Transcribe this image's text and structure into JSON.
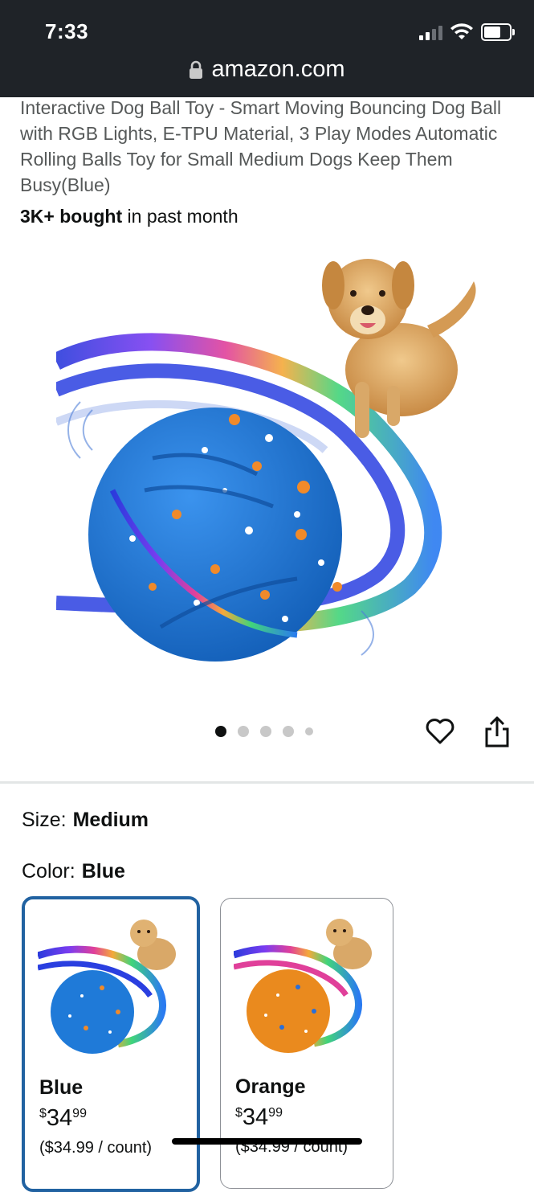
{
  "status_bar": {
    "time": "7:33"
  },
  "browser": {
    "url": "amazon.com"
  },
  "product": {
    "title": "Interactive Dog Ball Toy - Smart Moving Bouncing Dog Ball with RGB Lights, E-TPU Material, 3 Play Modes Automatic Rolling Balls Toy for Small Medium Dogs Keep Them Busy(Blue)",
    "bought_bold": "3K+ bought",
    "bought_rest": " in past month",
    "image_count": 5,
    "image_index": 1
  },
  "size": {
    "label": "Size:",
    "value": "Medium"
  },
  "color": {
    "label": "Color:",
    "value": "Blue"
  },
  "variants": [
    {
      "name": "Blue",
      "currency": "$",
      "price_whole": "34",
      "price_fraction": "99",
      "unit_price": "($34.99 / count)",
      "ball_color": "#1f7ad8",
      "selected": true
    },
    {
      "name": "Orange",
      "currency": "$",
      "price_whole": "34",
      "price_fraction": "99",
      "unit_price": "($34.99 / count)",
      "ball_color": "#ea8a1e",
      "selected": false
    }
  ],
  "icons": [
    "lock-icon",
    "wifi-icon",
    "battery-icon",
    "heart-icon",
    "share-icon"
  ]
}
